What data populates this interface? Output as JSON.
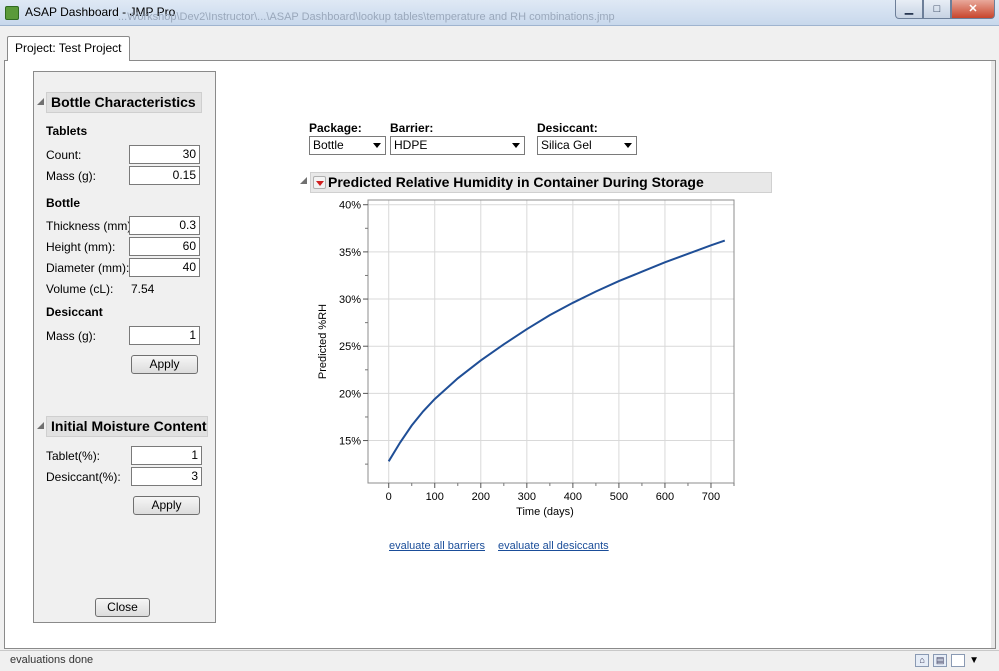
{
  "window": {
    "title": "ASAP Dashboard - JMP Pro",
    "ghost_path": "...Workshop\\Dev2\\Instructor\\...\\ASAP Dashboard\\lookup tables\\temperature and RH combinations.jmp",
    "minimize_glyph": "▁",
    "maximize_glyph": "□",
    "close_glyph": "✕"
  },
  "tab": {
    "label": "Project: Test Project"
  },
  "bottle_characteristics": {
    "heading": "Bottle Characteristics",
    "tablets_label": "Tablets",
    "count_label": "Count:",
    "count_value": "30",
    "tablet_mass_label": "Mass (g):",
    "tablet_mass_value": "0.15",
    "bottle_label": "Bottle",
    "thickness_label": "Thickness (mm):",
    "thickness_value": "0.3",
    "height_label": "Height (mm):",
    "height_value": "60",
    "diameter_label": "Diameter (mm):",
    "diameter_value": "40",
    "volume_label": "Volume (cL):",
    "volume_value": "7.54",
    "desiccant_label": "Desiccant",
    "desiccant_mass_label": "Mass (g):",
    "desiccant_mass_value": "1",
    "apply_label": "Apply"
  },
  "initial_moisture": {
    "heading": "Initial Moisture Content",
    "tablet_label": "Tablet(%):",
    "tablet_value": "1",
    "desiccant_label": "Desiccant(%):",
    "desiccant_value": "3",
    "apply_label": "Apply"
  },
  "close_button": {
    "label": "Close"
  },
  "selectors": {
    "package": {
      "label": "Package:",
      "value": "Bottle"
    },
    "barrier": {
      "label": "Barrier:",
      "value": "HDPE"
    },
    "desiccant": {
      "label": "Desiccant:",
      "value": "Silica Gel"
    }
  },
  "chart_title": "Predicted Relative Humidity in Container During Storage",
  "chart_data": {
    "type": "line",
    "title": "Predicted Relative Humidity in Container During Storage",
    "xlabel": "Time (days)",
    "ylabel": "Predicted %RH",
    "xlim": [
      -45,
      750
    ],
    "ylim": [
      10.5,
      40.5
    ],
    "x_ticks": [
      0,
      100,
      200,
      300,
      400,
      500,
      600,
      700
    ],
    "y_ticks": [
      15,
      20,
      25,
      30,
      35,
      40
    ],
    "y_tick_labels": [
      "15%",
      "20%",
      "25%",
      "30%",
      "35%",
      "40%"
    ],
    "grid": true,
    "line_color": "#1f4e96",
    "series": [
      {
        "x": [
          0,
          25,
          50,
          75,
          100,
          150,
          200,
          250,
          300,
          350,
          400,
          450,
          500,
          550,
          600,
          650,
          700,
          730
        ],
        "values": [
          12.8,
          14.8,
          16.6,
          18.1,
          19.4,
          21.6,
          23.5,
          25.2,
          26.8,
          28.3,
          29.6,
          30.8,
          31.9,
          32.9,
          33.9,
          34.8,
          35.7,
          36.2
        ]
      }
    ]
  },
  "links": {
    "evaluate_barriers": "evaluate all barriers",
    "evaluate_desiccants": "evaluate all desiccants"
  },
  "status": {
    "text": "evaluations done"
  }
}
